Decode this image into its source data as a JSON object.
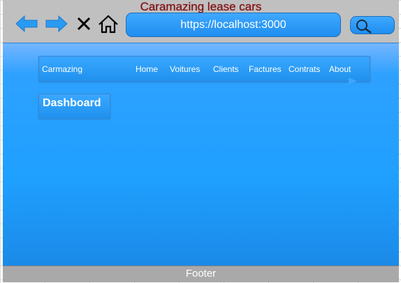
{
  "window": {
    "title": "Caramazing lease cars"
  },
  "toolbar": {
    "back_icon": "arrow-left-icon",
    "forward_icon": "arrow-right-icon",
    "close_icon": "close-icon",
    "home_icon": "home-icon",
    "search_icon": "search-icon",
    "url": "https://localhost:3000"
  },
  "site": {
    "brand": "Carmazing",
    "nav": [
      {
        "label": "Home"
      },
      {
        "label": "Voitures"
      },
      {
        "label": "Clients"
      },
      {
        "label": "Factures"
      },
      {
        "label": "Contrats"
      },
      {
        "label": "About"
      }
    ],
    "page_button": "Dashboard",
    "footer": "Footer"
  },
  "colors": {
    "accent": "#1e9bff",
    "title": "#7a1012",
    "chrome": "#c0c0c0",
    "footer": "#a9a9a9"
  }
}
